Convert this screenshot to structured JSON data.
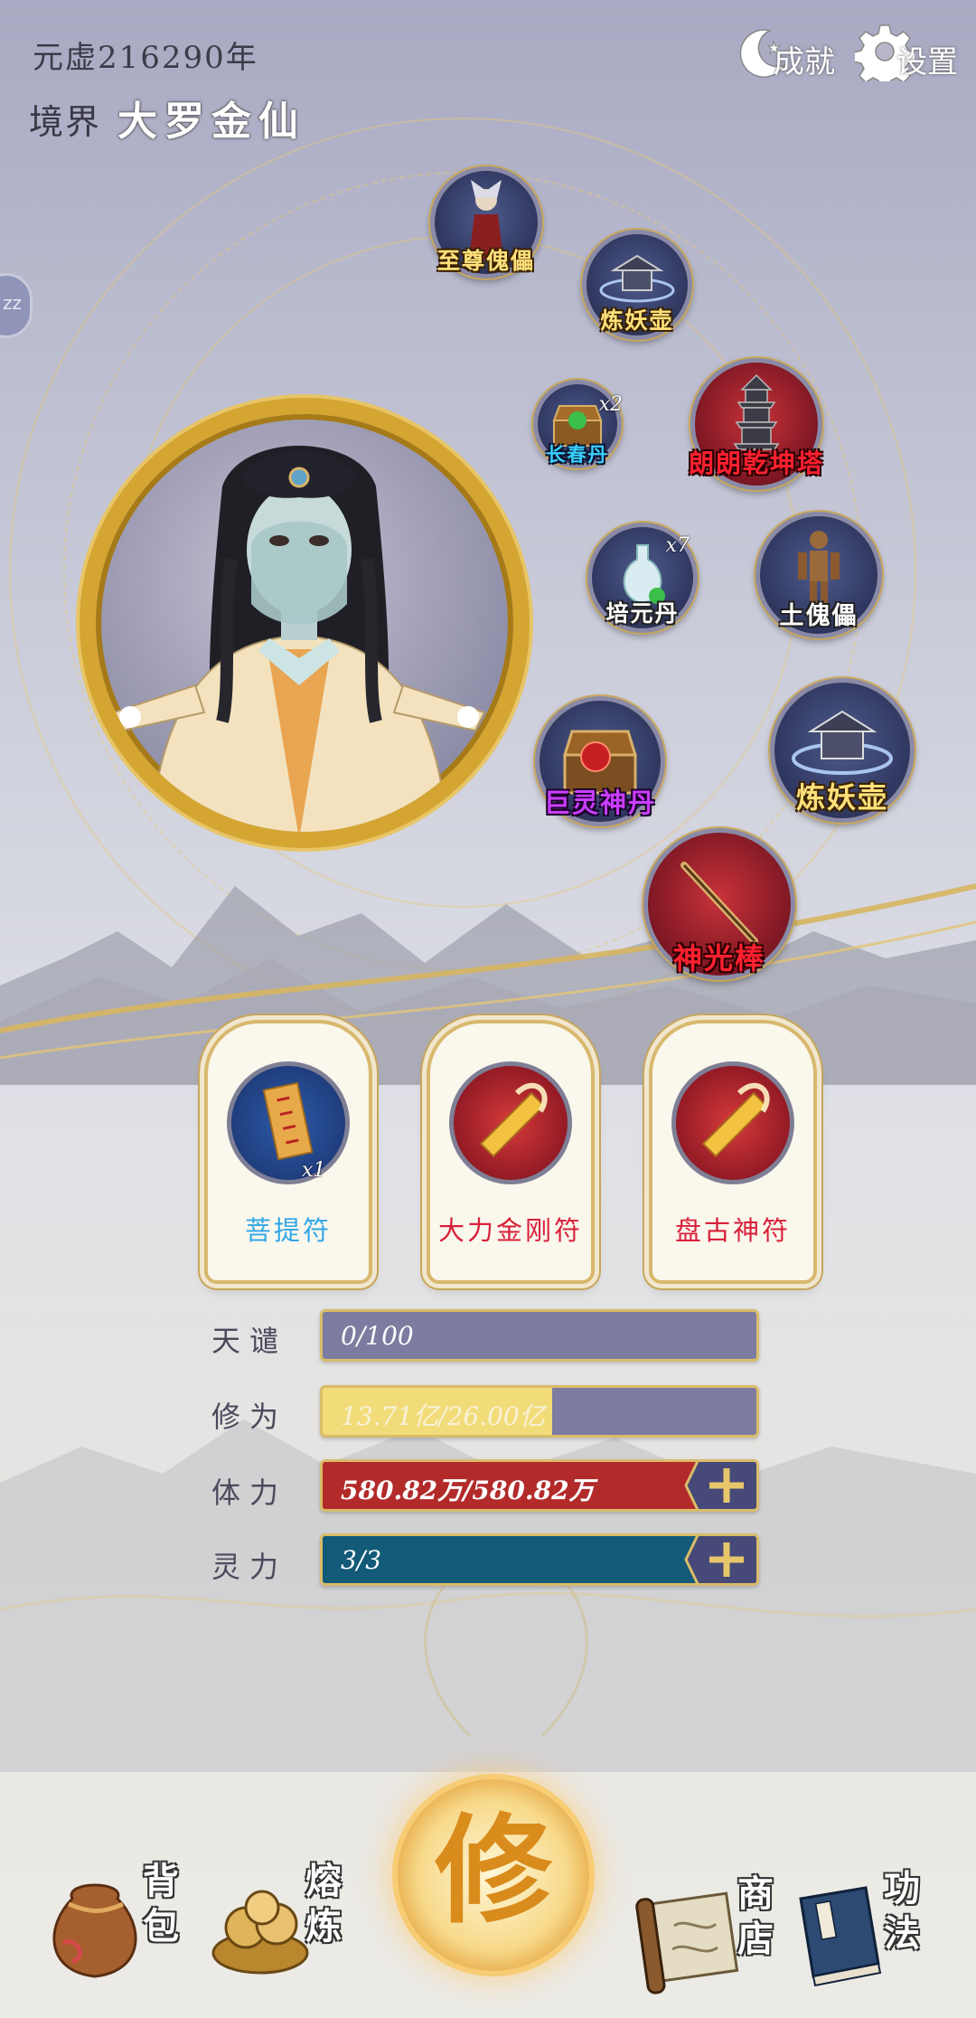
{
  "header": {
    "year": "元虚216290年",
    "realm_label": "境界",
    "realm_value": "大罗金仙",
    "achievements_label": "成就",
    "settings_label": "设置"
  },
  "side_tab": {
    "label": "zz"
  },
  "items": [
    {
      "name": "至尊傀儡",
      "color": "gold"
    },
    {
      "name": "炼妖壶",
      "color": "gold"
    },
    {
      "name": "长春丹",
      "color": "blue",
      "count": "x2"
    },
    {
      "name": "朗朗乾坤塔",
      "color": "red"
    },
    {
      "name": "培元丹",
      "color": "white",
      "count": "x7"
    },
    {
      "name": "土傀儡",
      "color": "white"
    },
    {
      "name": "巨灵神丹",
      "color": "purple"
    },
    {
      "name": "炼妖壶",
      "color": "gold"
    },
    {
      "name": "神光棒",
      "color": "red"
    }
  ],
  "talismans": [
    {
      "name": "菩提符",
      "count": "x1",
      "color": "#2fa7e8"
    },
    {
      "name": "大力金刚符",
      "color": "#d8203a"
    },
    {
      "name": "盘古神符",
      "color": "#d8203a"
    }
  ],
  "stats": [
    {
      "label": "天谴",
      "value": "0/100",
      "fill": 0,
      "color": "#7b7ca0"
    },
    {
      "label": "修为",
      "value": "13.71亿/26.00亿",
      "fill": 0.53,
      "color": "#f2dc7a"
    },
    {
      "label": "体力",
      "value": "580.82万/580.82万",
      "fill": 1,
      "color": "#b22a2a",
      "plus": true
    },
    {
      "label": "灵力",
      "value": "3/3",
      "fill": 1,
      "color": "#125a78",
      "plus": true
    }
  ],
  "bottom_nav": {
    "bag": "背包",
    "smelt": "熔炼",
    "cultivate": "修",
    "shop": "商店",
    "skills": "功法"
  },
  "colors": {
    "gold_border": "#d4a531",
    "bar_border": "#d9bc6a"
  }
}
